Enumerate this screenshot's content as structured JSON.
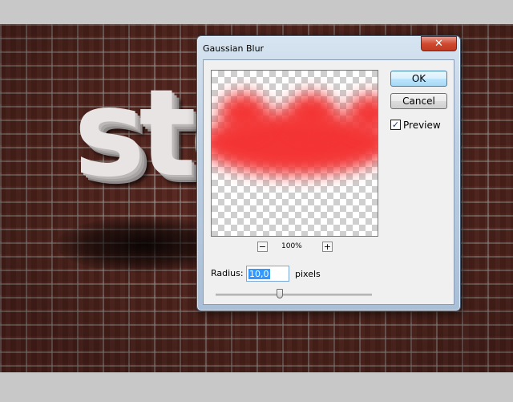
{
  "artwork": {
    "text": "sto"
  },
  "dialog": {
    "title": "Gaussian Blur",
    "close_glyph": "✕",
    "zoom": {
      "level": "100%",
      "out_glyph": "−",
      "in_glyph": "+"
    },
    "buttons": {
      "ok": "OK",
      "cancel": "Cancel"
    },
    "preview": {
      "label": "Preview",
      "checked": true,
      "check_glyph": "✓"
    },
    "radius": {
      "label": "Radius:",
      "value": "10,0",
      "unit": "pixels",
      "slider_fraction": 0.41
    },
    "colors": {
      "preview_fill": "#f43535",
      "close_button": "#c9442c",
      "ok_border": "#3c7fb1"
    }
  }
}
